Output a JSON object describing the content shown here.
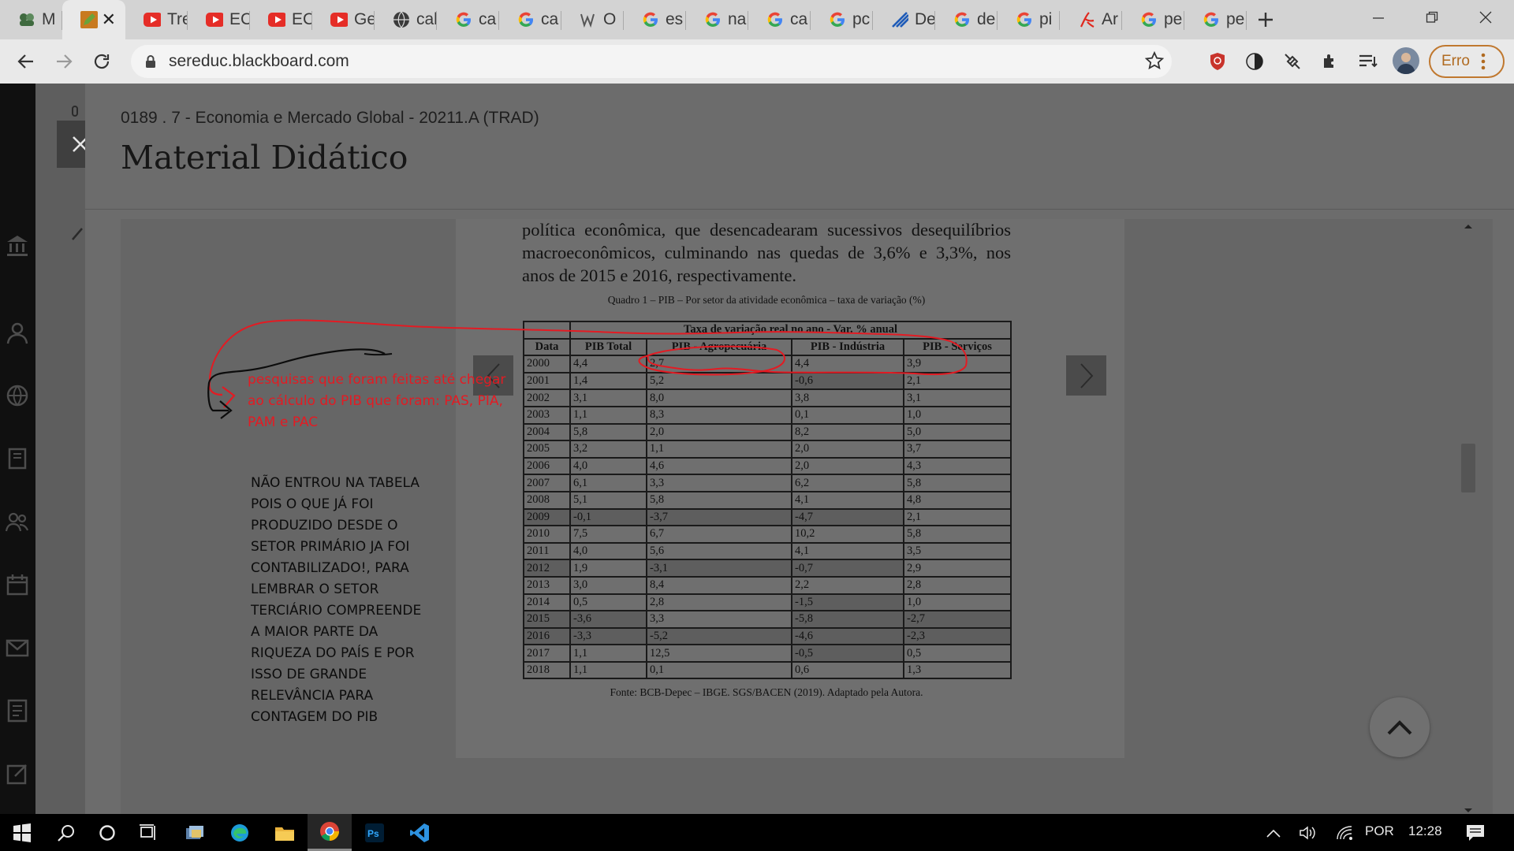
{
  "browser": {
    "tabs": [
      {
        "title": "M",
        "icon": "users-icon"
      },
      {
        "title": "",
        "icon": "pencil-app-icon",
        "active": true
      },
      {
        "title": "Tre",
        "icon": "youtube-icon"
      },
      {
        "title": "EC",
        "icon": "youtube-icon"
      },
      {
        "title": "EC",
        "icon": "youtube-icon"
      },
      {
        "title": "Ge",
        "icon": "youtube-icon"
      },
      {
        "title": "cal",
        "icon": "globe-icon"
      },
      {
        "title": "ca",
        "icon": "google-icon"
      },
      {
        "title": "ca",
        "icon": "google-icon"
      },
      {
        "title": "O",
        "icon": "site-icon"
      },
      {
        "title": "es",
        "icon": "google-icon"
      },
      {
        "title": "na",
        "icon": "google-icon"
      },
      {
        "title": "ca",
        "icon": "google-icon"
      },
      {
        "title": "pc",
        "icon": "google-icon"
      },
      {
        "title": "De",
        "icon": "stripes-icon"
      },
      {
        "title": "de",
        "icon": "google-icon"
      },
      {
        "title": "pi",
        "icon": "google-icon"
      },
      {
        "title": "Ar",
        "icon": "adobe-icon"
      },
      {
        "title": "pe",
        "icon": "google-icon"
      },
      {
        "title": "pe",
        "icon": "google-icon"
      }
    ],
    "url": "sereduc.blackboard.com",
    "profile_status": "Erro"
  },
  "course": {
    "title": "0189 . 7 - Economia e Mercado Global - 20211.A (TRAD)",
    "section": "Material Didático"
  },
  "document": {
    "paragraph": "política econômica, que desencadearam sucessivos desequilíbrios macroeconômicos, culminando nas quedas de 3,6% e 3,3%, nos anos de 2015 e 2016, respectivamente.",
    "caption": "Quadro 1 – PIB – Por setor da atividade econômica – taxa de variação (%)",
    "table_header_main": "Taxa de variação real no ano - Var. % anual",
    "columns": [
      "Data",
      "PIB Total",
      "PIB - Agropecuária",
      "PIB - Indústria",
      "PIB - Serviços"
    ],
    "rows": [
      [
        "2000",
        "4,4",
        "2,7",
        "4,4",
        "3,9"
      ],
      [
        "2001",
        "1,4",
        "5,2",
        "-0,6",
        "2,1"
      ],
      [
        "2002",
        "3,1",
        "8,0",
        "3,8",
        "3,1"
      ],
      [
        "2003",
        "1,1",
        "8,3",
        "0,1",
        "1,0"
      ],
      [
        "2004",
        "5,8",
        "2,0",
        "8,2",
        "5,0"
      ],
      [
        "2005",
        "3,2",
        "1,1",
        "2,0",
        "3,7"
      ],
      [
        "2006",
        "4,0",
        "4,6",
        "2,0",
        "4,3"
      ],
      [
        "2007",
        "6,1",
        "3,3",
        "6,2",
        "5,8"
      ],
      [
        "2008",
        "5,1",
        "5,8",
        "4,1",
        "4,8"
      ],
      [
        "2009",
        "-0,1",
        "-3,7",
        "-4,7",
        "2,1"
      ],
      [
        "2010",
        "7,5",
        "6,7",
        "10,2",
        "5,8"
      ],
      [
        "2011",
        "4,0",
        "5,6",
        "4,1",
        "3,5"
      ],
      [
        "2012",
        "1,9",
        "-3,1",
        "-0,7",
        "2,9"
      ],
      [
        "2013",
        "3,0",
        "8,4",
        "2,2",
        "2,8"
      ],
      [
        "2014",
        "0,5",
        "2,8",
        "-1,5",
        "1,0"
      ],
      [
        "2015",
        "-3,6",
        "3,3",
        "-5,8",
        "-2,7"
      ],
      [
        "2016",
        "-3,3",
        "-5,2",
        "-4,6",
        "-2,3"
      ],
      [
        "2017",
        "1,1",
        "12,5",
        "-0,5",
        "0,5"
      ],
      [
        "2018",
        "1,1",
        "0,1",
        "0,6",
        "1,3"
      ]
    ],
    "source": "Fonte: BCB-Depec – IBGE. SGS/BACEN (2019). Adaptado pela Autora."
  },
  "annotations": {
    "red_note": "pesquisas que foram feitas até chegar ao cálculo do PIB que foram: PAS, PIA, PAM e PAC",
    "black_note": "NÃO ENTROU NA TABELA POIS O QUE JÁ FOI PRODUZIDO DESDE O SETOR PRIMÁRIO JA FOI CONTABILIZADO!, PARA LEMBRAR O SETOR TERCIÁRIO COMPREENDE A MAIOR PARTE DA RIQUEZA DO PAÍS E POR ISSO DE GRANDE RELEVÂNCIA PARA CONTAGEM DO PIB",
    "red_color": "#e31b23",
    "black_color": "#0c0c0c"
  },
  "taskbar": {
    "apps": [
      "windows-start-icon",
      "search-icon",
      "cortana-icon",
      "task-view-icon",
      "file-manager-app-icon",
      "edge-icon",
      "folder-icon",
      "chrome-icon",
      "photoshop-icon",
      "vscode-icon"
    ],
    "language": "POR",
    "time": "12:28"
  },
  "colors": {
    "accent_youtube": "#e52d27",
    "erro_orange": "#c0782f"
  }
}
